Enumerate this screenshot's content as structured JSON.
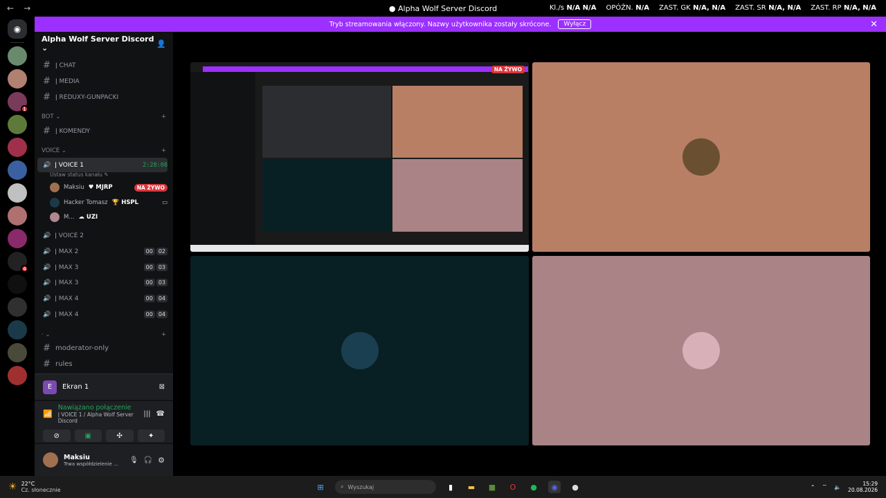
{
  "window": {
    "title": "Alpha Wolf Server Discord",
    "back": "←",
    "forward": "→"
  },
  "stats": [
    {
      "label": "Kl./s",
      "value": "N/A  N/A"
    },
    {
      "label": "OPÓŹN.",
      "value": "N/A"
    },
    {
      "label": "ZAST. GK",
      "value": "N/A, N/A"
    },
    {
      "label": "ZAST. SR",
      "value": "N/A, N/A"
    },
    {
      "label": "ZAST. RP",
      "value": "N/A, N/A"
    }
  ],
  "banner": {
    "text": "Tryb streamowania włączony. Nazwy użytkownika zostały skrócone.",
    "button": "Wyłącz"
  },
  "guild": {
    "name": "Alpha Wolf Server Discord ⌄"
  },
  "channels": {
    "chat": "ǀ CHAT",
    "media": "ǀ MEDIA",
    "reduxy": "ǀ REDUXY-GUNPACKI",
    "bot_cat": "BOT ⌄",
    "komendy": "ǀ KOMENDY",
    "voice_cat": "VOICE ⌄",
    "voice1": "ǀ VOICE 1",
    "voice1_timer": "2:28:08",
    "voice1_status": "Ustaw status kanału ✎",
    "users": [
      {
        "name": "Maksiu",
        "tag": "♥ MJRP",
        "live": "NA ŻYWO"
      },
      {
        "name": "Hacker Tomasz",
        "tag": "🏆 HSPL",
        "live": ""
      },
      {
        "name": "M...",
        "tag": "☁ UZI",
        "live": ""
      }
    ],
    "voice2": "ǀ VOICE 2",
    "max": [
      {
        "label": "ǀ MAX 2",
        "a": "00",
        "b": "02"
      },
      {
        "label": "ǀ MAX 3",
        "a": "00",
        "b": "03"
      },
      {
        "label": "ǀ MAX 3",
        "a": "00",
        "b": "03"
      },
      {
        "label": "ǀ MAX 4",
        "a": "00",
        "b": "04"
      },
      {
        "label": "ǀ MAX 4",
        "a": "00",
        "b": "04"
      }
    ],
    "dots_cat": "· ⌄",
    "moderator": "moderator-only",
    "rules": "rules"
  },
  "screen": {
    "letter": "E",
    "title": "Ekran 1"
  },
  "connection": {
    "status": "Nawiązano połączenie",
    "detail": "ǀ VOICE 1 / Alpha Wolf Server Discord"
  },
  "profile": {
    "name": "Maksiu",
    "status": "Trwa współdzielenie ..."
  },
  "stage": {
    "live": "NA ŻYWO"
  },
  "taskbar": {
    "temp": "22°C",
    "weather": "Cz. słonecznie",
    "search": "Wyszukaj",
    "time": "15:29",
    "date": "20.08.2026"
  },
  "colors": {
    "accent": "#9b30ff",
    "tile1": "#b97f65",
    "tile2": "#082024",
    "tile3": "#a98385",
    "online": "#23a55a",
    "live": "#da373c"
  }
}
